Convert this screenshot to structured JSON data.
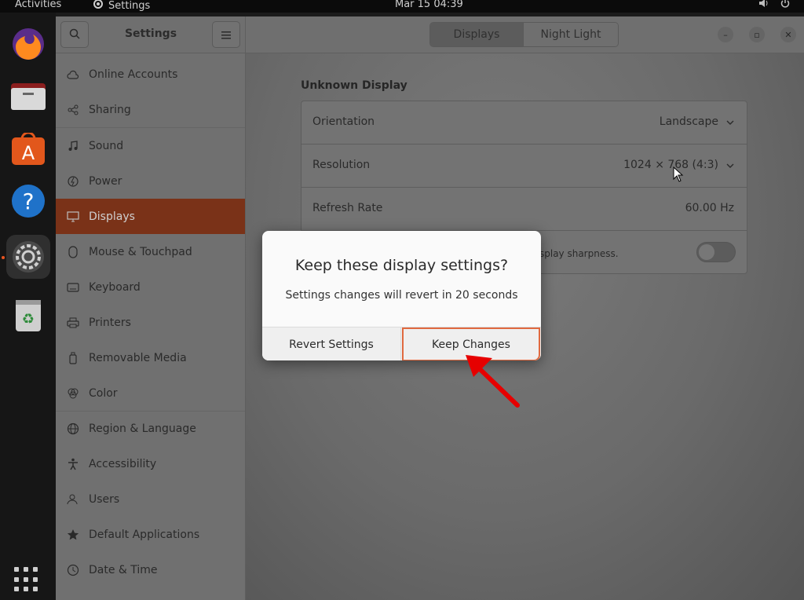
{
  "topbar": {
    "activities": "Activities",
    "app_name": "Settings",
    "clock": "Mar 15  04:39",
    "icons": [
      "volume-icon",
      "power-icon"
    ]
  },
  "dock": {
    "items": [
      "firefox",
      "files",
      "ubuntu-software",
      "help",
      "settings",
      "trash"
    ],
    "active": "settings",
    "show_apps": "show-applications-icon"
  },
  "window": {
    "sidebar_title": "Settings",
    "tabs": [
      {
        "label": "Displays",
        "selected": true
      },
      {
        "label": "Night Light",
        "selected": false
      }
    ]
  },
  "sidebar": {
    "items": [
      {
        "label": "Online Accounts",
        "icon": "cloud-icon"
      },
      {
        "label": "Sharing",
        "icon": "share-icon"
      },
      {
        "label": "Sound",
        "icon": "music-note-icon"
      },
      {
        "label": "Power",
        "icon": "power-icon"
      },
      {
        "label": "Displays",
        "icon": "monitor-icon",
        "selected": true
      },
      {
        "label": "Mouse & Touchpad",
        "icon": "mouse-icon"
      },
      {
        "label": "Keyboard",
        "icon": "keyboard-icon"
      },
      {
        "label": "Printers",
        "icon": "printer-icon"
      },
      {
        "label": "Removable Media",
        "icon": "usb-drive-icon"
      },
      {
        "label": "Color",
        "icon": "color-icon"
      },
      {
        "label": "Region & Language",
        "icon": "globe-icon"
      },
      {
        "label": "Accessibility",
        "icon": "accessibility-icon"
      },
      {
        "label": "Users",
        "icon": "users-icon"
      },
      {
        "label": "Default Applications",
        "icon": "star-icon"
      },
      {
        "label": "Date & Time",
        "icon": "clock-icon"
      }
    ]
  },
  "display": {
    "section_title": "Unknown Display",
    "orientation": {
      "label": "Orientation",
      "value": "Landscape"
    },
    "resolution": {
      "label": "Resolution",
      "value": "1024 × 768 (4:3)"
    },
    "refresh_rate": {
      "label": "Refresh Rate",
      "value": "60.00 Hz"
    },
    "scaling_note": "splay sharpness."
  },
  "dialog": {
    "title": "Keep these display settings?",
    "message": "Settings changes will revert in 20 seconds",
    "revert_label": "Revert Settings",
    "keep_label": "Keep Changes"
  },
  "colors": {
    "accent": "#e95420",
    "selected_sidebar": "#7a3218",
    "annotation_arrow": "#e60000"
  }
}
